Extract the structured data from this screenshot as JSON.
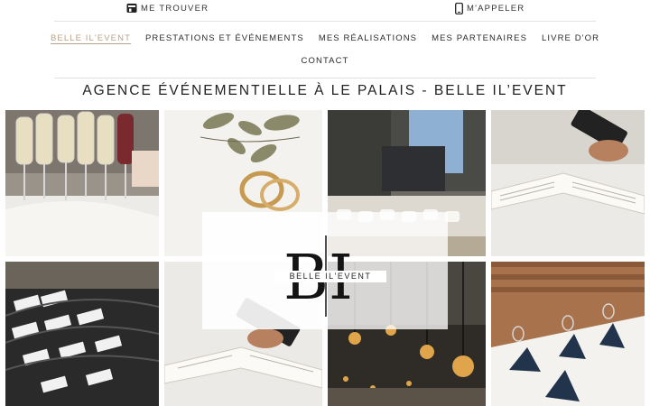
{
  "topbar": {
    "find_label": "ME TROUVER",
    "call_label": "M'APPELER",
    "find_icon": "store-icon",
    "call_icon": "phone-icon"
  },
  "nav": {
    "items": [
      {
        "label": "BELLE IL'EVENT",
        "active": true
      },
      {
        "label": "PRESTATIONS ET ÉVÉNEMENTS"
      },
      {
        "label": "MES RÉALISATIONS"
      },
      {
        "label": "MES PARTENAIRES"
      },
      {
        "label": "LIVRE D'OR"
      },
      {
        "label": "CONTACT"
      }
    ],
    "active_color": "#b9a289"
  },
  "page_title": "AGENCE ÉVÉNEMENTIELLE À LE PALAIS - BELLE IL’EVENT",
  "logo": {
    "monogram": "BI",
    "text": "BELLE IL'EVENT"
  },
  "gallery": [
    {
      "subject": "champagne-glasses"
    },
    {
      "subject": "wedding-rings"
    },
    {
      "subject": "buffet-service"
    },
    {
      "subject": "guest-book-phone"
    },
    {
      "subject": "name-badges"
    },
    {
      "subject": "guest-book-phone"
    },
    {
      "subject": "string-lights"
    },
    {
      "subject": "table-setting"
    }
  ]
}
